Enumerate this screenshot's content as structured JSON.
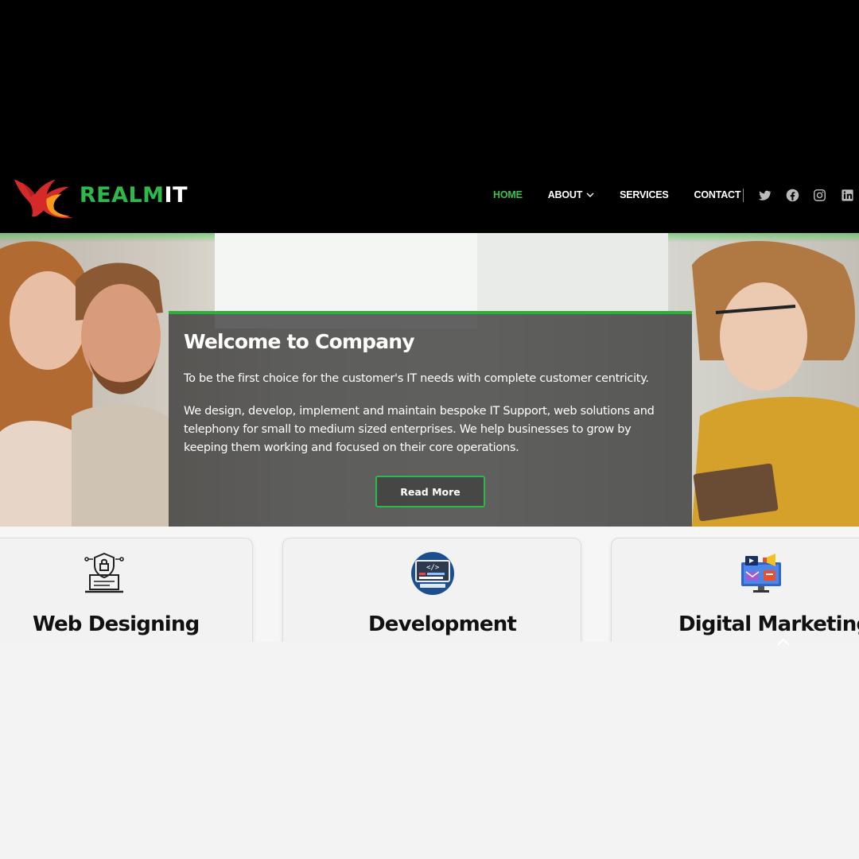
{
  "brand": {
    "name_green": "REALM",
    "name_white": "IT"
  },
  "nav": {
    "items": [
      {
        "label": "HOME",
        "active": true
      },
      {
        "label": "ABOUT",
        "has_dropdown": true
      },
      {
        "label": "SERVICES"
      },
      {
        "label": "CONTACT"
      }
    ],
    "social": [
      "twitter-icon",
      "facebook-icon",
      "instagram-icon",
      "linkedin-icon"
    ]
  },
  "hero": {
    "title": "Welcome to Company",
    "paragraph1": "To be the first choice for the customer's IT needs with complete customer centricity.",
    "paragraph2": "We design, develop, implement and maintain bespoke IT Support, web solutions and telephony for small to medium sized enterprises. We help businesses to grow by keeping them working and focused on their core operations.",
    "button": "Read More"
  },
  "services": [
    {
      "title": "Web Designing",
      "icon": "security-laptop-icon"
    },
    {
      "title": "Development",
      "icon": "code-monitor-icon"
    },
    {
      "title": "Digital Marketing",
      "icon": "marketing-monitor-icon"
    }
  ],
  "colors": {
    "accent": "#2eb84b",
    "header_bg": "#000000",
    "page_bg": "#f3f3f3"
  }
}
